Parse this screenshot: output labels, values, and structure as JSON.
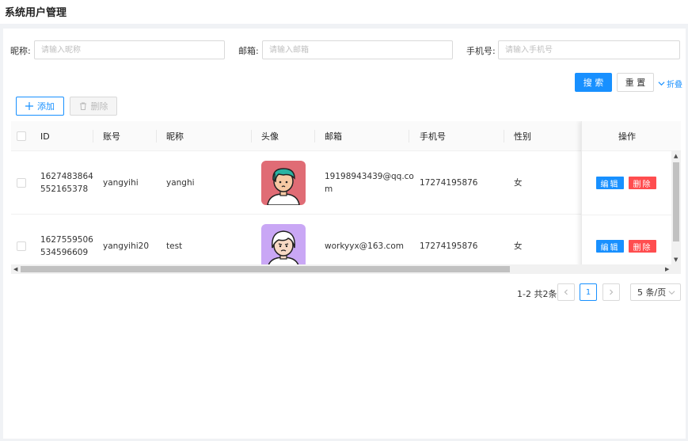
{
  "header": {
    "title": "系统用户管理"
  },
  "search": {
    "nickname_label": "昵称:",
    "nickname_placeholder": "请输入昵称",
    "email_label": "邮箱:",
    "email_placeholder": "请输入邮箱",
    "phone_label": "手机号:",
    "phone_placeholder": "请输入手机号",
    "search_button": "搜 索",
    "reset_button": "重 置",
    "collapse_link": "折叠"
  },
  "toolbar": {
    "add_button": "添加",
    "delete_button": "删除"
  },
  "table": {
    "columns": [
      "ID",
      "账号",
      "昵称",
      "头像",
      "邮箱",
      "手机号",
      "性别",
      "操作"
    ],
    "rows": [
      {
        "id_line1": "1627483864",
        "id_line2": "552165378",
        "account": "yangyihi",
        "nickname": "yanghi",
        "email_line1": "19198943439@qq.co",
        "email_line2": "m",
        "phone": "17274195876",
        "gender": "女",
        "edit": "编辑",
        "delete": "删除"
      },
      {
        "id_line1": "1627559506",
        "id_line2": "534596609",
        "account": "yangyihi20",
        "nickname": "test",
        "email_line1": "workyyx@163.com",
        "email_line2": "",
        "phone": "17274195876",
        "gender": "女",
        "edit": "编辑",
        "delete": "删除"
      }
    ]
  },
  "pagination": {
    "total_text": "1-2 共2条",
    "current_page": "1",
    "page_size": "5 条/页"
  },
  "colors": {
    "primary": "#1890ff",
    "danger": "#ff4d4f",
    "avatar1_bg": "#e06c75",
    "avatar2_bg": "#c9a7f5"
  }
}
